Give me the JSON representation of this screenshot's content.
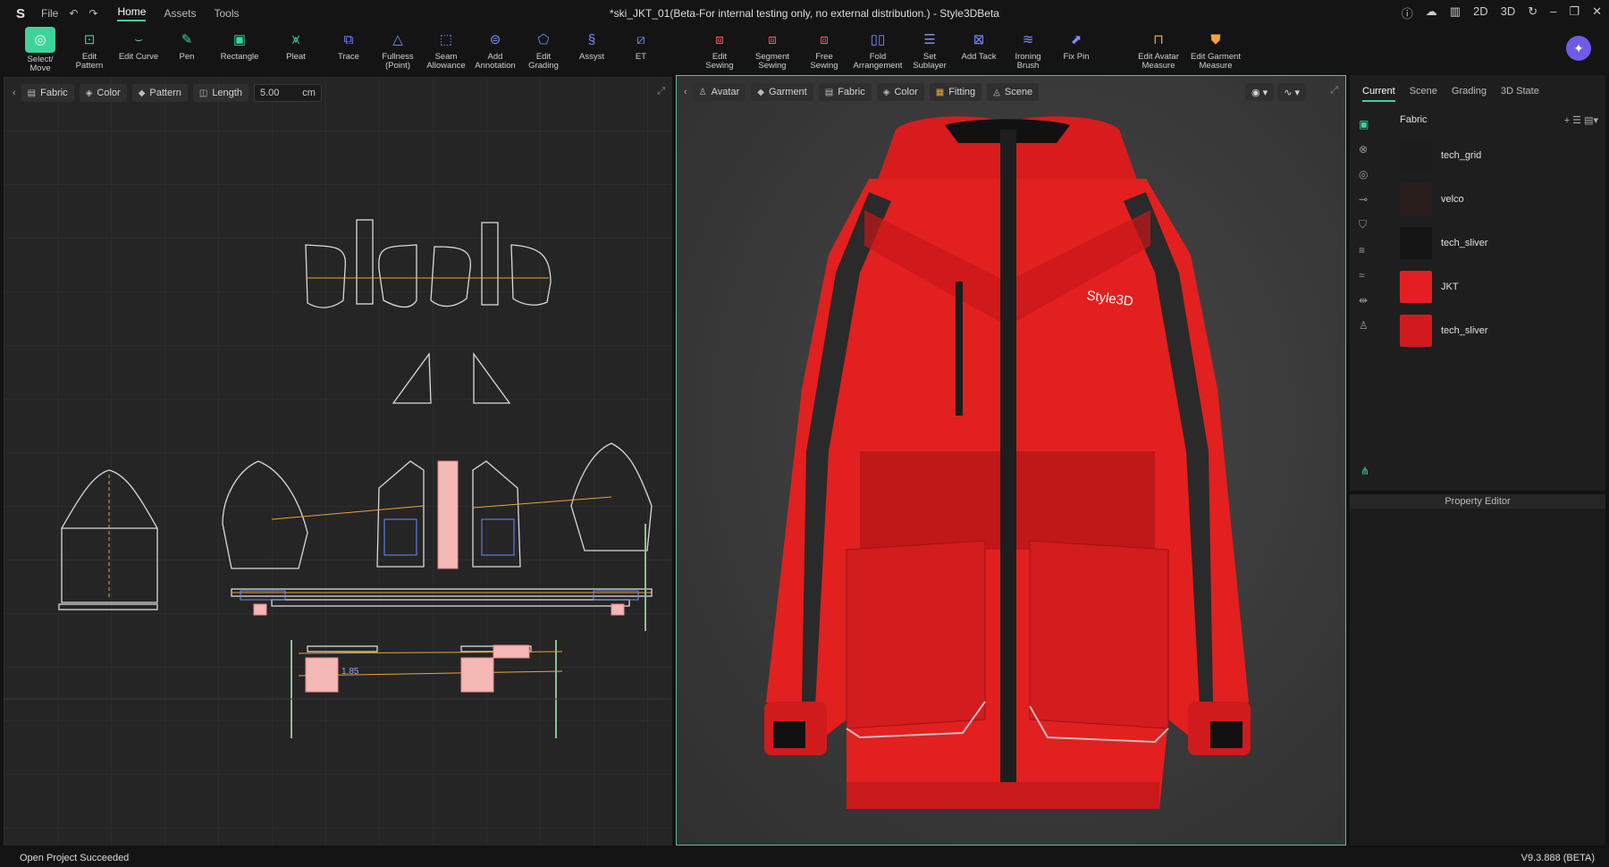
{
  "title_menu": {
    "file": "File",
    "home": "Home",
    "assets": "Assets",
    "tools": "Tools"
  },
  "window_title": "*ski_JKT_01(Beta-For internal testing only, no external distribution.) - Style3DBeta",
  "window_controls": [
    "2D",
    "3D"
  ],
  "toolbar": [
    {
      "label1": "Select/",
      "label2": "Move",
      "icon": "select-icon"
    },
    {
      "label1": "Edit",
      "label2": "Pattern",
      "icon": "edit-pattern-icon"
    },
    {
      "label1": "Edit Curve",
      "label2": "",
      "icon": "edit-curve-icon"
    },
    {
      "label1": "Pen",
      "label2": "",
      "icon": "pen-icon"
    },
    {
      "label1": "Rectangle",
      "label2": "",
      "icon": "rectangle-icon"
    },
    {
      "label1": "Pleat",
      "label2": "",
      "icon": "pleat-icon"
    },
    {
      "label1": "Trace",
      "label2": "",
      "icon": "trace-icon"
    },
    {
      "label1": "Fullness",
      "label2": "(Point)",
      "icon": "fullness-icon"
    },
    {
      "label1": "Seam",
      "label2": "Allowance",
      "icon": "seam-allowance-icon"
    },
    {
      "label1": "Add",
      "label2": "Annotation",
      "icon": "annotation-icon"
    },
    {
      "label1": "Edit",
      "label2": "Grading",
      "icon": "grading-icon"
    },
    {
      "label1": "Assyst",
      "label2": "",
      "icon": "assyst-icon"
    },
    {
      "label1": "ET",
      "label2": "",
      "icon": "et-icon"
    },
    {
      "label1": "Edit",
      "label2": "Sewing",
      "icon": "edit-sewing-icon"
    },
    {
      "label1": "Segment",
      "label2": "Sewing",
      "icon": "segment-sewing-icon"
    },
    {
      "label1": "Free",
      "label2": "Sewing",
      "icon": "free-sewing-icon"
    },
    {
      "label1": "Fold",
      "label2": "Arrangement",
      "icon": "fold-icon"
    },
    {
      "label1": "Set",
      "label2": "Sublayer",
      "icon": "sublayer-icon"
    },
    {
      "label1": "Add Tack",
      "label2": "",
      "icon": "tack-icon"
    },
    {
      "label1": "Ironing",
      "label2": "Brush",
      "icon": "ironing-icon"
    },
    {
      "label1": "Fix Pin",
      "label2": "",
      "icon": "pin-icon"
    },
    {
      "label1": "Edit Avatar",
      "label2": "Measure",
      "icon": "avatar-measure-icon"
    },
    {
      "label1": "Edit Garment",
      "label2": "Measure",
      "icon": "garment-measure-icon"
    }
  ],
  "panel2d": {
    "fabric": "Fabric",
    "color": "Color",
    "pattern": "Pattern",
    "length": "Length",
    "length_value": "5.00",
    "unit": "cm",
    "measure": "1.85"
  },
  "panel3d": {
    "avatar": "Avatar",
    "garment": "Garment",
    "fabric": "Fabric",
    "color": "Color",
    "fitting": "Fitting",
    "scene": "Scene",
    "brand_label": "Style3D"
  },
  "right_panel": {
    "tabs": [
      "Current",
      "Scene",
      "Grading",
      "3D State"
    ],
    "section": "Fabric",
    "fabrics": [
      {
        "name": "tech_grid",
        "color": "#1c1c1c"
      },
      {
        "name": "velco",
        "color": "#2a1e1c"
      },
      {
        "name": "tech_sliver",
        "color": "#151515"
      },
      {
        "name": "JKT",
        "color": "#e41e22"
      },
      {
        "name": "tech_sliver",
        "color": "#d11a1e"
      }
    ]
  },
  "property_editor": "Property Editor",
  "status": {
    "message": "Open Project Succeeded",
    "version": "V9.3.888 (BETA)"
  },
  "colors": {
    "accent": "#3ed39a",
    "jacket": "#e2201f"
  }
}
